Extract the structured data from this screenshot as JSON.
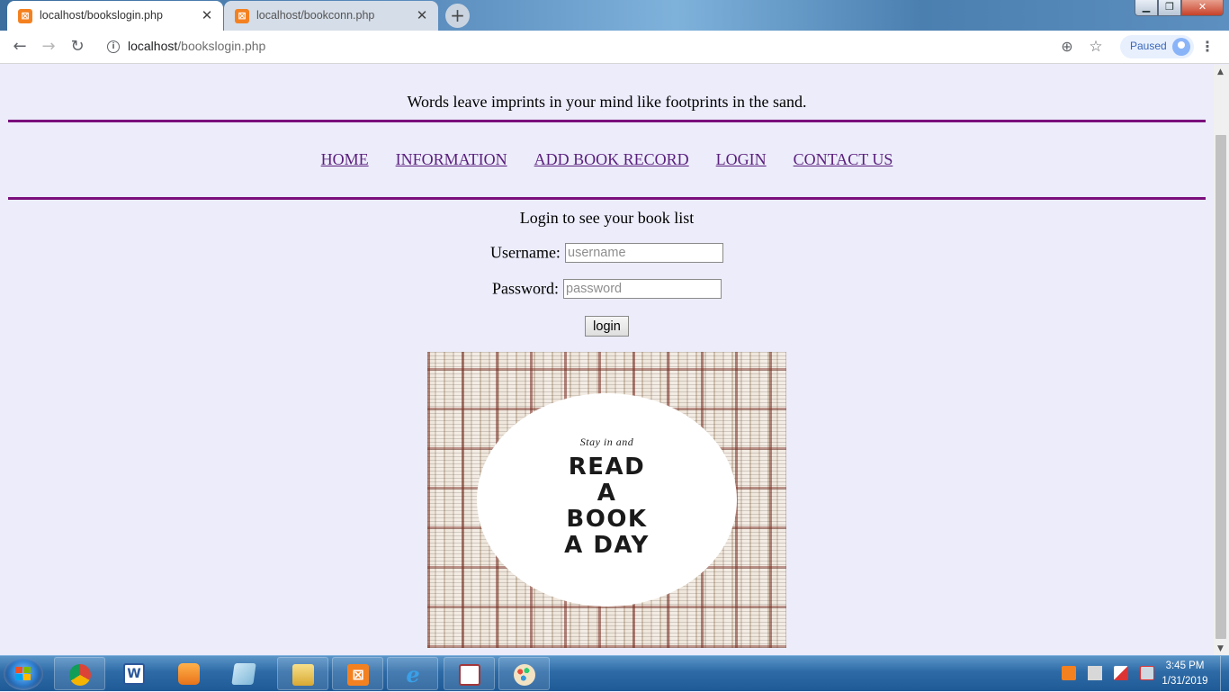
{
  "browser": {
    "tabs": [
      {
        "title": "localhost/bookslogin.php",
        "active": true
      },
      {
        "title": "localhost/bookconn.php",
        "active": false
      }
    ],
    "new_tab_icon": "plus-icon",
    "url_host": "localhost",
    "url_path": "/bookslogin.php",
    "profile_status": "Paused"
  },
  "page": {
    "quote": "Words leave imprints in your mind like footprints in the sand.",
    "nav": [
      "HOME",
      "INFORMATION",
      "ADD BOOK RECORD",
      "LOGIN",
      "CONTACT US"
    ],
    "login_title": "Login to see your book list",
    "username_label": "Username:",
    "username_placeholder": "username",
    "password_label": "Password:",
    "password_placeholder": "password",
    "login_button": "login",
    "poster": {
      "subtitle": "Stay in and",
      "lines": [
        "READ",
        "A",
        "BOOK",
        "A DAY"
      ]
    }
  },
  "colors": {
    "page_background": "#ececfb",
    "divider": "#7b0f7b",
    "link": "#5a1f7c"
  },
  "taskbar": {
    "pinned_apps": [
      "chrome",
      "word",
      "media-player",
      "notes",
      "file-explorer",
      "xampp",
      "internet-explorer",
      "access",
      "paint"
    ],
    "clock_time": "3:45 PM",
    "clock_date": "1/31/2019"
  }
}
